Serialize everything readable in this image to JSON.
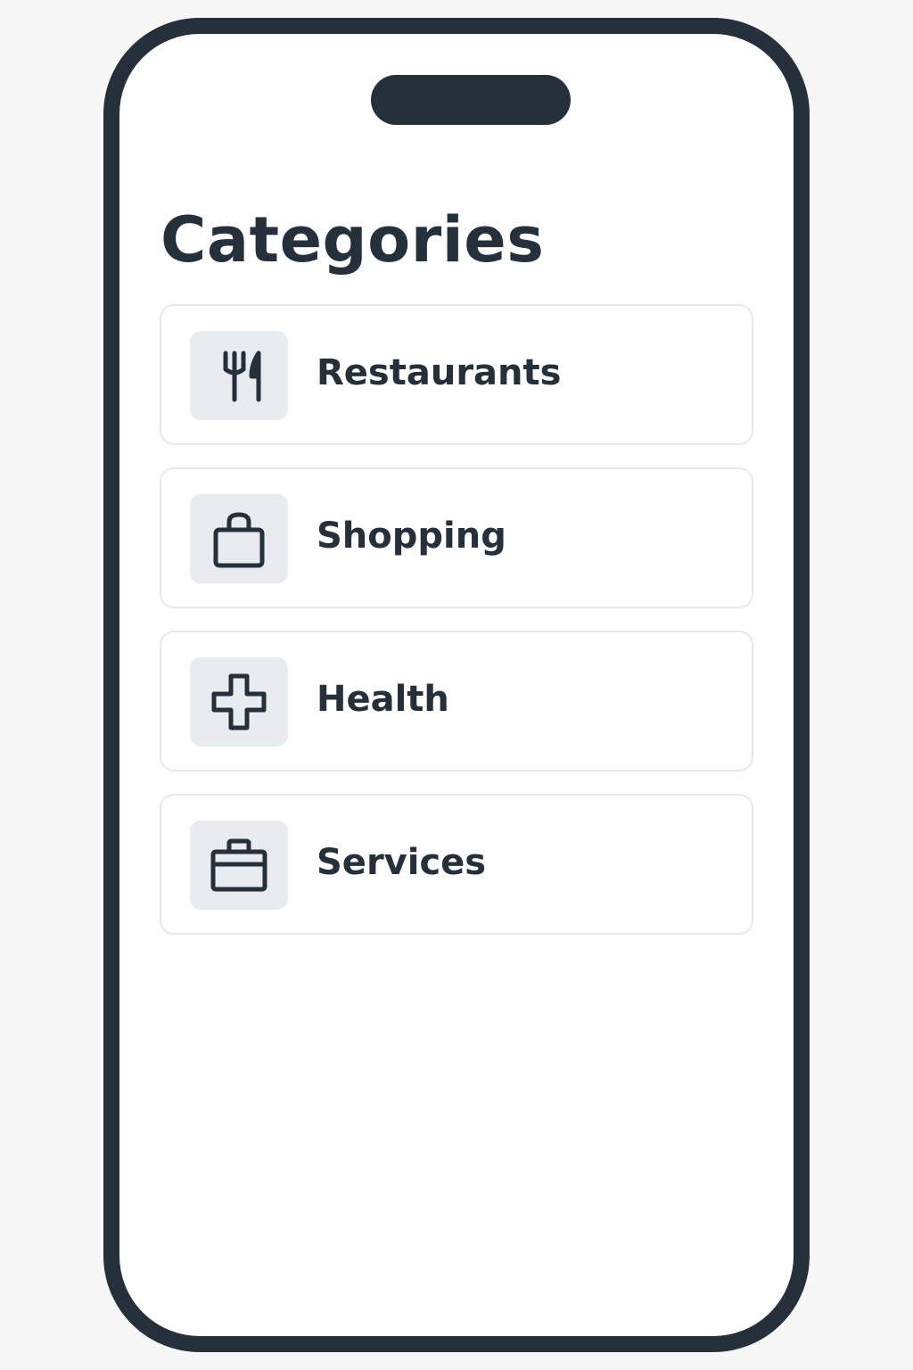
{
  "page": {
    "title": "Categories"
  },
  "categories": [
    {
      "label": "Restaurants",
      "icon": "fork-knife-icon"
    },
    {
      "label": "Shopping",
      "icon": "shopping-bag-icon"
    },
    {
      "label": "Health",
      "icon": "medical-cross-icon"
    },
    {
      "label": "Services",
      "icon": "briefcase-icon"
    }
  ],
  "colors": {
    "frame": "#25303b",
    "text": "#25303b",
    "icon_bg": "#e8ebef",
    "card_border": "#e7e9ec"
  }
}
